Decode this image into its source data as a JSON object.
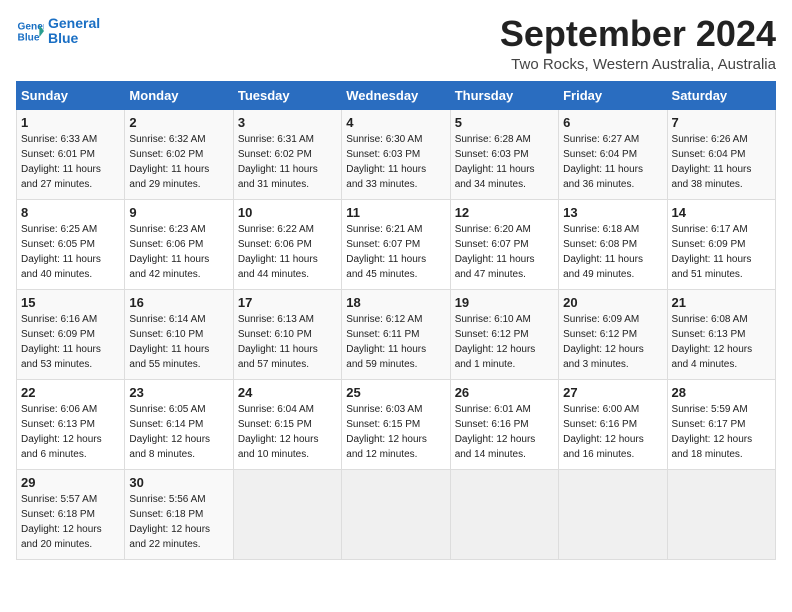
{
  "header": {
    "logo_line1": "General",
    "logo_line2": "Blue",
    "month_title": "September 2024",
    "location": "Two Rocks, Western Australia, Australia"
  },
  "days_of_week": [
    "Sunday",
    "Monday",
    "Tuesday",
    "Wednesday",
    "Thursday",
    "Friday",
    "Saturday"
  ],
  "weeks": [
    [
      {
        "num": "1",
        "info": "Sunrise: 6:33 AM\nSunset: 6:01 PM\nDaylight: 11 hours\nand 27 minutes."
      },
      {
        "num": "2",
        "info": "Sunrise: 6:32 AM\nSunset: 6:02 PM\nDaylight: 11 hours\nand 29 minutes."
      },
      {
        "num": "3",
        "info": "Sunrise: 6:31 AM\nSunset: 6:02 PM\nDaylight: 11 hours\nand 31 minutes."
      },
      {
        "num": "4",
        "info": "Sunrise: 6:30 AM\nSunset: 6:03 PM\nDaylight: 11 hours\nand 33 minutes."
      },
      {
        "num": "5",
        "info": "Sunrise: 6:28 AM\nSunset: 6:03 PM\nDaylight: 11 hours\nand 34 minutes."
      },
      {
        "num": "6",
        "info": "Sunrise: 6:27 AM\nSunset: 6:04 PM\nDaylight: 11 hours\nand 36 minutes."
      },
      {
        "num": "7",
        "info": "Sunrise: 6:26 AM\nSunset: 6:04 PM\nDaylight: 11 hours\nand 38 minutes."
      }
    ],
    [
      {
        "num": "8",
        "info": "Sunrise: 6:25 AM\nSunset: 6:05 PM\nDaylight: 11 hours\nand 40 minutes."
      },
      {
        "num": "9",
        "info": "Sunrise: 6:23 AM\nSunset: 6:06 PM\nDaylight: 11 hours\nand 42 minutes."
      },
      {
        "num": "10",
        "info": "Sunrise: 6:22 AM\nSunset: 6:06 PM\nDaylight: 11 hours\nand 44 minutes."
      },
      {
        "num": "11",
        "info": "Sunrise: 6:21 AM\nSunset: 6:07 PM\nDaylight: 11 hours\nand 45 minutes."
      },
      {
        "num": "12",
        "info": "Sunrise: 6:20 AM\nSunset: 6:07 PM\nDaylight: 11 hours\nand 47 minutes."
      },
      {
        "num": "13",
        "info": "Sunrise: 6:18 AM\nSunset: 6:08 PM\nDaylight: 11 hours\nand 49 minutes."
      },
      {
        "num": "14",
        "info": "Sunrise: 6:17 AM\nSunset: 6:09 PM\nDaylight: 11 hours\nand 51 minutes."
      }
    ],
    [
      {
        "num": "15",
        "info": "Sunrise: 6:16 AM\nSunset: 6:09 PM\nDaylight: 11 hours\nand 53 minutes."
      },
      {
        "num": "16",
        "info": "Sunrise: 6:14 AM\nSunset: 6:10 PM\nDaylight: 11 hours\nand 55 minutes."
      },
      {
        "num": "17",
        "info": "Sunrise: 6:13 AM\nSunset: 6:10 PM\nDaylight: 11 hours\nand 57 minutes."
      },
      {
        "num": "18",
        "info": "Sunrise: 6:12 AM\nSunset: 6:11 PM\nDaylight: 11 hours\nand 59 minutes."
      },
      {
        "num": "19",
        "info": "Sunrise: 6:10 AM\nSunset: 6:12 PM\nDaylight: 12 hours\nand 1 minute."
      },
      {
        "num": "20",
        "info": "Sunrise: 6:09 AM\nSunset: 6:12 PM\nDaylight: 12 hours\nand 3 minutes."
      },
      {
        "num": "21",
        "info": "Sunrise: 6:08 AM\nSunset: 6:13 PM\nDaylight: 12 hours\nand 4 minutes."
      }
    ],
    [
      {
        "num": "22",
        "info": "Sunrise: 6:06 AM\nSunset: 6:13 PM\nDaylight: 12 hours\nand 6 minutes."
      },
      {
        "num": "23",
        "info": "Sunrise: 6:05 AM\nSunset: 6:14 PM\nDaylight: 12 hours\nand 8 minutes."
      },
      {
        "num": "24",
        "info": "Sunrise: 6:04 AM\nSunset: 6:15 PM\nDaylight: 12 hours\nand 10 minutes."
      },
      {
        "num": "25",
        "info": "Sunrise: 6:03 AM\nSunset: 6:15 PM\nDaylight: 12 hours\nand 12 minutes."
      },
      {
        "num": "26",
        "info": "Sunrise: 6:01 AM\nSunset: 6:16 PM\nDaylight: 12 hours\nand 14 minutes."
      },
      {
        "num": "27",
        "info": "Sunrise: 6:00 AM\nSunset: 6:16 PM\nDaylight: 12 hours\nand 16 minutes."
      },
      {
        "num": "28",
        "info": "Sunrise: 5:59 AM\nSunset: 6:17 PM\nDaylight: 12 hours\nand 18 minutes."
      }
    ],
    [
      {
        "num": "29",
        "info": "Sunrise: 5:57 AM\nSunset: 6:18 PM\nDaylight: 12 hours\nand 20 minutes."
      },
      {
        "num": "30",
        "info": "Sunrise: 5:56 AM\nSunset: 6:18 PM\nDaylight: 12 hours\nand 22 minutes."
      },
      {
        "num": "",
        "info": ""
      },
      {
        "num": "",
        "info": ""
      },
      {
        "num": "",
        "info": ""
      },
      {
        "num": "",
        "info": ""
      },
      {
        "num": "",
        "info": ""
      }
    ]
  ]
}
